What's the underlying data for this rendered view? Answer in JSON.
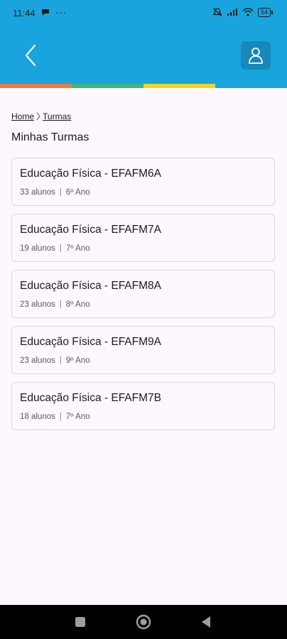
{
  "status_bar": {
    "time": "11:44",
    "dots": "···",
    "icons": [
      "chat-bubble-icon",
      "bell-off-icon",
      "signal-icon",
      "wifi-icon",
      "battery-icon"
    ],
    "battery": "54"
  },
  "header": {
    "background_color": "#1aa4dd",
    "back_icon": "chevron-left-icon",
    "profile_icon": "user-icon",
    "color_strip": [
      "#f07a3f",
      "#3fb47a",
      "#f2d51c",
      "#1aa4dd"
    ]
  },
  "breadcrumb": {
    "items": [
      "Home",
      "Turmas"
    ]
  },
  "page_title": "Minhas Turmas",
  "classes": [
    {
      "name": "Educação Física - EFAFM6A",
      "students": "33 alunos",
      "separator": "|",
      "grade": "6º Ano"
    },
    {
      "name": "Educação Física - EFAFM7A",
      "students": "19 alunos",
      "separator": "|",
      "grade": "7º Ano"
    },
    {
      "name": "Educação Física - EFAFM8A",
      "students": "23 alunos",
      "separator": "|",
      "grade": "8º Ano"
    },
    {
      "name": "Educação Física - EFAFM9A",
      "students": "23 alunos",
      "separator": "|",
      "grade": "9º Ano"
    },
    {
      "name": "Educação Física - EFAFM7B",
      "students": "18 alunos",
      "separator": "|",
      "grade": "7º Ano"
    }
  ],
  "nav_bar": {
    "icons": [
      "recents-square-icon",
      "home-circle-icon",
      "back-triangle-icon"
    ]
  }
}
